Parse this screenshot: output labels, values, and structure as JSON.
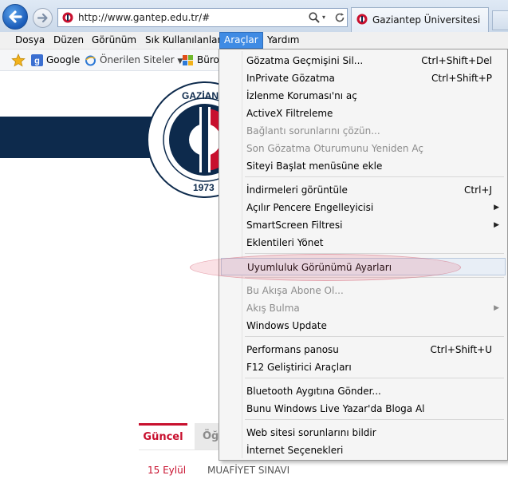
{
  "browser": {
    "address": "http://www.gantep.edu.tr/#",
    "tab_title": "Gaziantep Üniversitesi"
  },
  "menubar": {
    "items": [
      "Dosya",
      "Düzen",
      "Görünüm",
      "Sık Kullanılanlar",
      "Araçlar",
      "Yardım"
    ],
    "active": "Araçlar"
  },
  "favorites": {
    "items": [
      "Google",
      "Önerilen Siteler",
      "Büro"
    ]
  },
  "page": {
    "logo_text_top": "GAZİANTEP ÜNİ",
    "logo_year": "1973",
    "tabs": [
      "Güncel",
      "Öğ"
    ],
    "news_date": "15 Eylül",
    "news_title": "MUAFİYET SINAVI"
  },
  "tools_menu": {
    "items": [
      {
        "label": "Gözatma Geçmişini Sil...",
        "shortcut": "Ctrl+Shift+Del"
      },
      {
        "label": "InPrivate Gözatma",
        "shortcut": "Ctrl+Shift+P"
      },
      {
        "label": "İzlenme Koruması'nı aç",
        "shortcut": ""
      },
      {
        "label": "ActiveX Filtreleme",
        "shortcut": ""
      },
      {
        "label": "Bağlantı sorunlarını çözün...",
        "shortcut": "",
        "disabled": true
      },
      {
        "label": "Son Gözatma Oturumunu Yeniden Aç",
        "shortcut": "",
        "disabled": true
      },
      {
        "label": "Siteyi Başlat menüsüne ekle",
        "shortcut": ""
      },
      {
        "label": "İndirmeleri görüntüle",
        "shortcut": "Ctrl+J"
      },
      {
        "label": "Açılır Pencere Engelleyicisi",
        "shortcut": "",
        "submenu": true
      },
      {
        "label": "SmartScreen Filtresi",
        "shortcut": "",
        "submenu": true
      },
      {
        "label": "Eklentileri Yönet",
        "shortcut": ""
      },
      {
        "label": "Uyumluluk Görünümü Ayarları",
        "shortcut": "",
        "highlighted": true
      },
      {
        "label": "Bu Akışa Abone Ol...",
        "shortcut": "",
        "disabled": true
      },
      {
        "label": "Akış Bulma",
        "shortcut": "",
        "disabled": true,
        "submenu": true
      },
      {
        "label": "Windows Update",
        "shortcut": ""
      },
      {
        "label": "Performans panosu",
        "shortcut": "Ctrl+Shift+U"
      },
      {
        "label": "F12 Geliştirici Araçları",
        "shortcut": ""
      },
      {
        "label": "Bluetooth Aygıtına Gönder...",
        "shortcut": ""
      },
      {
        "label": "Bunu Windows Live Yazar'da Bloga Al",
        "shortcut": ""
      },
      {
        "label": "Web sitesi sorunlarını bildir",
        "shortcut": ""
      },
      {
        "label": "İnternet Seçenekleri",
        "shortcut": ""
      }
    ]
  },
  "colors": {
    "accent": "#3f8be4",
    "university_red": "#c8102e",
    "banner_navy": "#0d2a4c",
    "annotation": "#e65a6e"
  }
}
